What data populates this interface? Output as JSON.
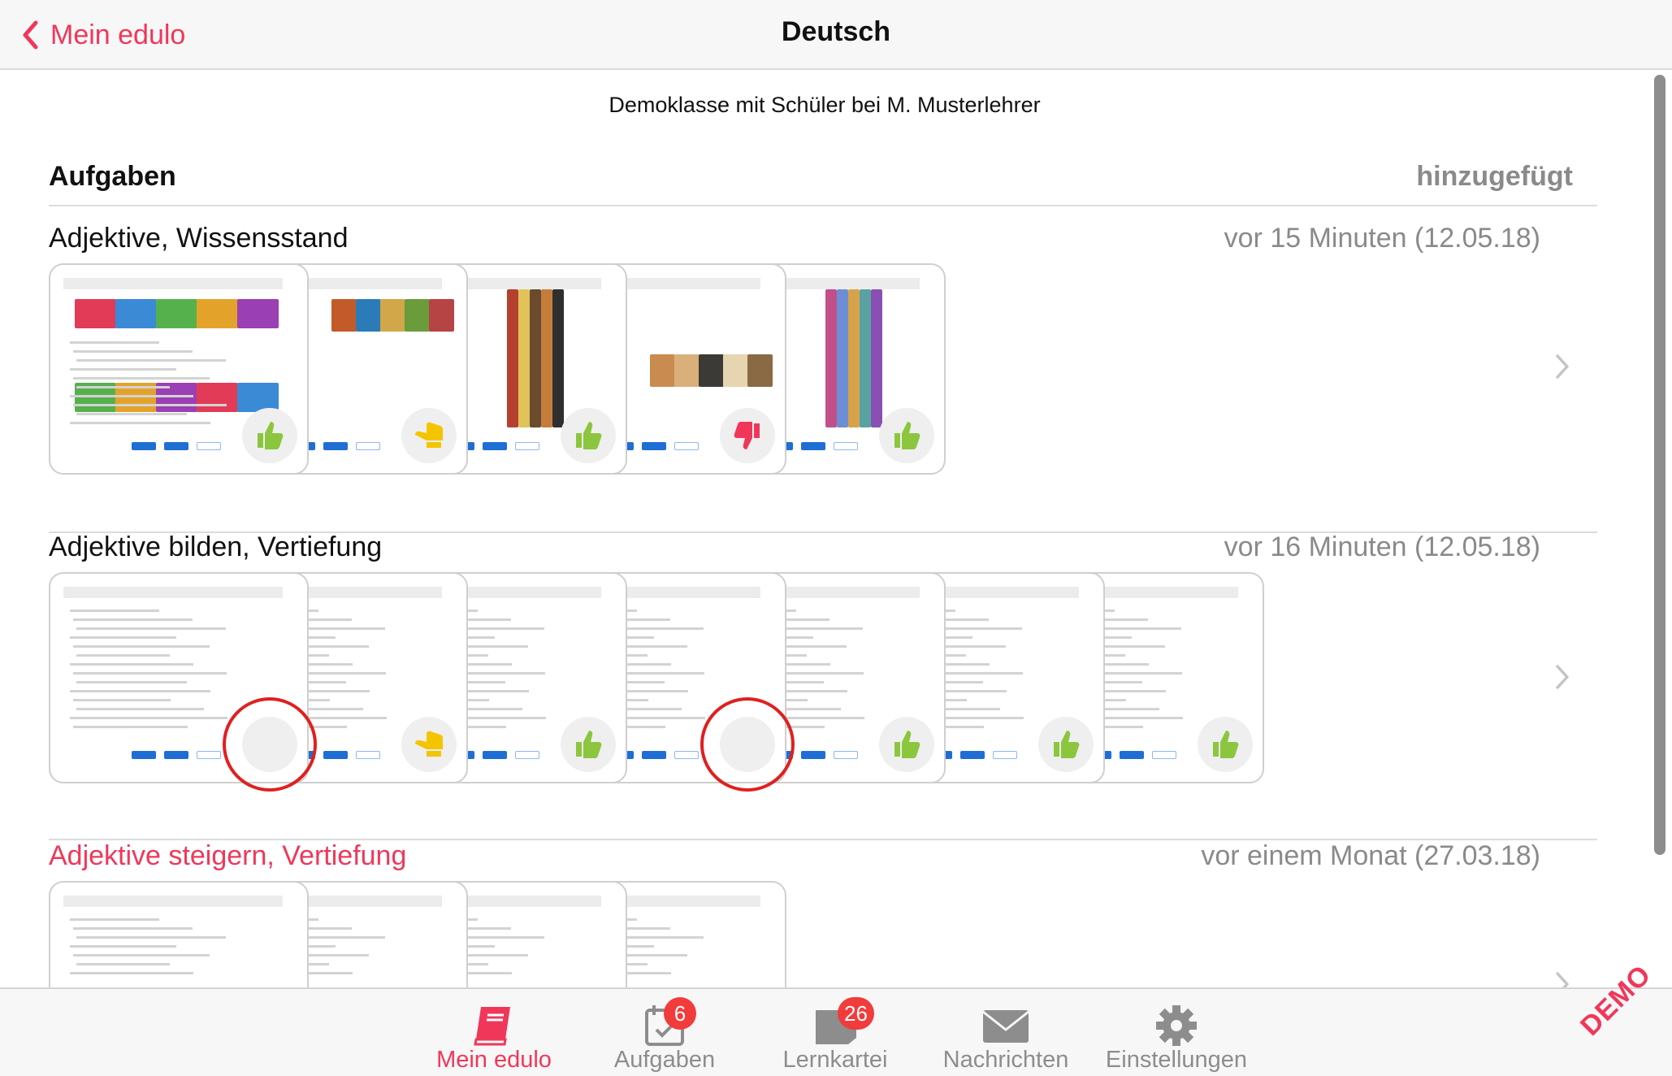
{
  "nav": {
    "back_label": "Mein edulo",
    "title": "Deutsch"
  },
  "class_info": "Demoklasse mit Schüler bei M. Musterlehrer",
  "section": {
    "left": "Aufgaben",
    "right": "hinzugefügt"
  },
  "groups": [
    {
      "name": "Adjektive, Wissensstand",
      "time": "vor 15 Minuten (12.05.18)",
      "cards": [
        "thumbs-up",
        "thumbs-side",
        "thumbs-up",
        "thumbs-down",
        "thumbs-up"
      ]
    },
    {
      "name": "Adjektive bilden, Vertiefung",
      "time": "vor 16 Minuten (12.05.18)",
      "cards": [
        "pending",
        "thumbs-side",
        "thumbs-up",
        "pending",
        "thumbs-up",
        "thumbs-up",
        "thumbs-up"
      ]
    },
    {
      "name": "Adjektive steigern, Vertiefung",
      "time": "vor einem Monat (27.03.18)",
      "cards": [
        "none",
        "none",
        "none",
        "none"
      ]
    }
  ],
  "colors": {
    "accent": "#f0375a",
    "thumb_up": "#8cc63f",
    "thumb_side": "#f5c400",
    "thumb_down": "#f0375a",
    "badge": "#f23b3b"
  },
  "tabbar": {
    "items": [
      {
        "label": "Mein edulo",
        "icon": "book-icon",
        "active": true
      },
      {
        "label": "Aufgaben",
        "icon": "calendar-check-icon",
        "count": "6"
      },
      {
        "label": "Lernkartei",
        "icon": "card-box-icon",
        "count": "26"
      },
      {
        "label": "Nachrichten",
        "icon": "envelope-icon"
      },
      {
        "label": "Einstellungen",
        "icon": "gear-icon"
      }
    ]
  },
  "watermark": "DEMO"
}
